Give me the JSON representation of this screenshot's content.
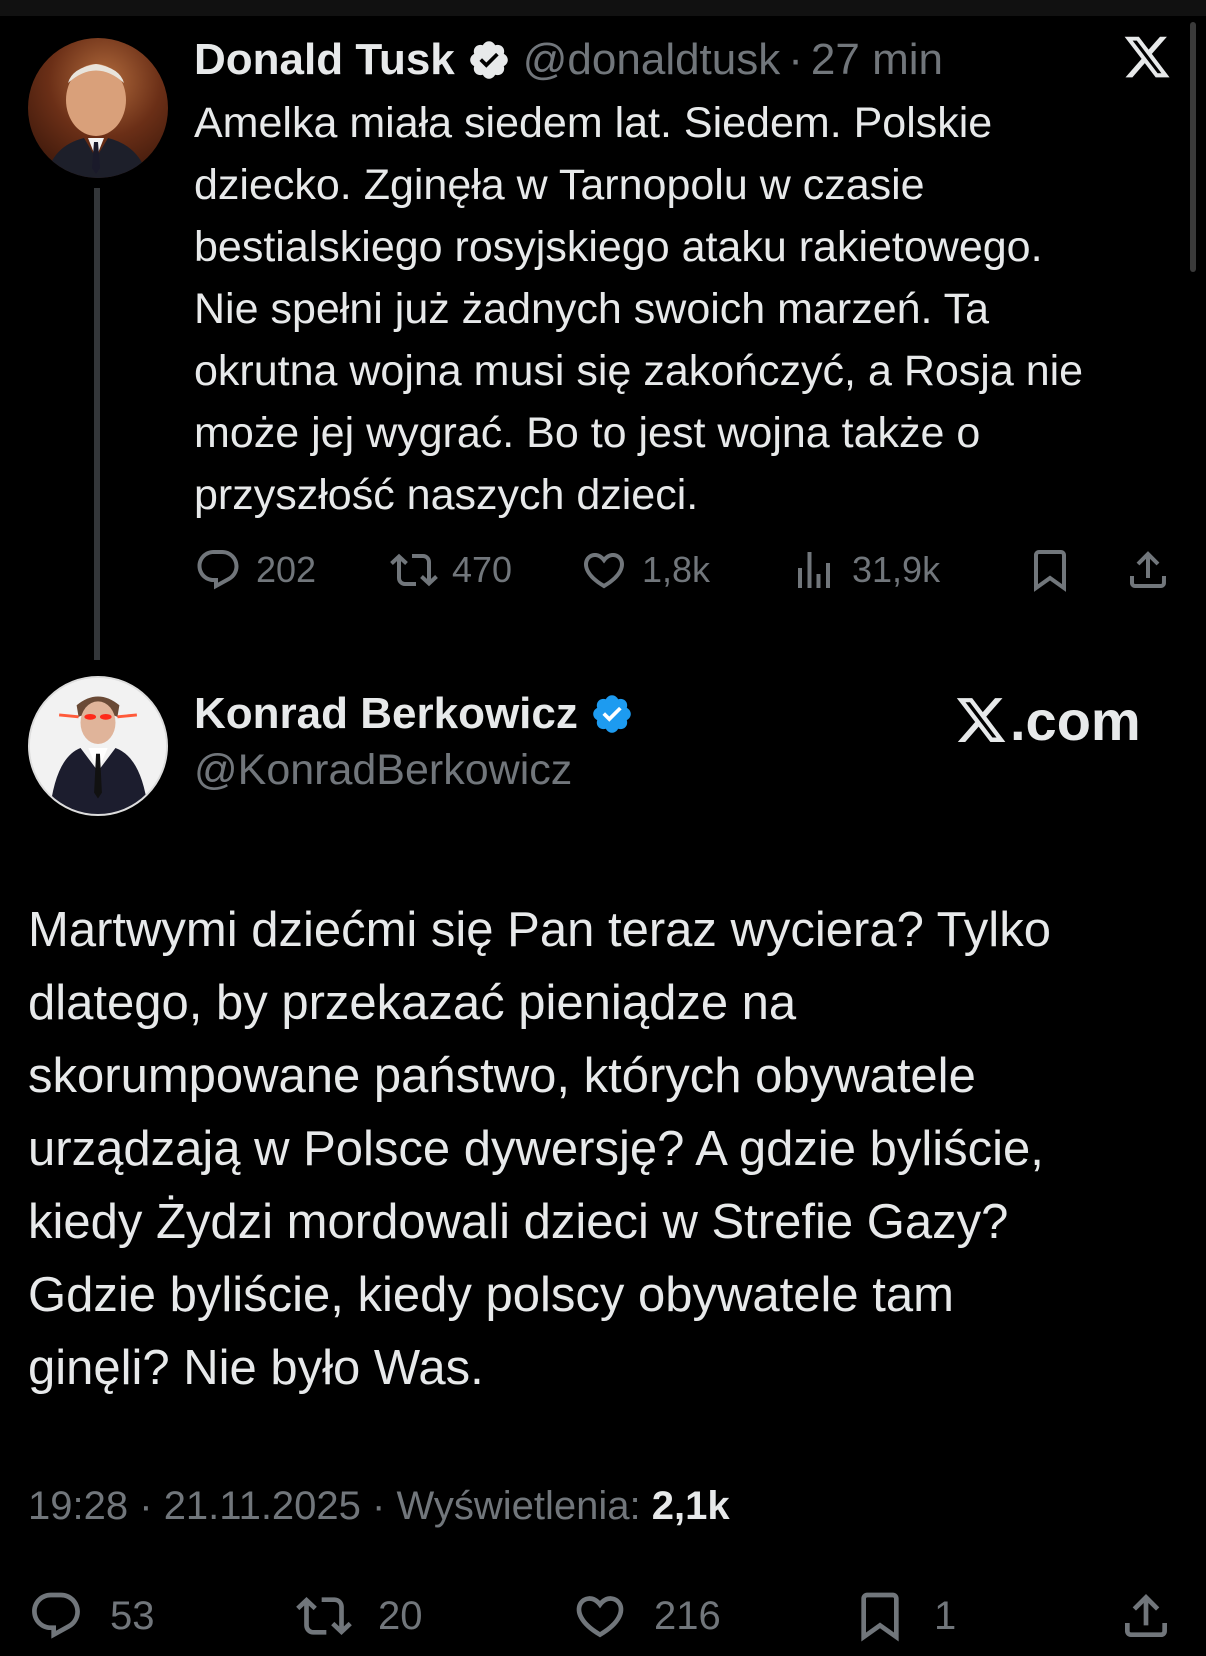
{
  "quoted_tweet": {
    "name": "Donald Tusk",
    "handle": "@donaldtusk",
    "separator": "·",
    "time": "27 min",
    "text_lines": [
      "Amelka miała siedem lat. Siedem. Polskie",
      "dziecko. Zginęła w Tarnopolu w czasie",
      "bestialskiego rosyjskiego ataku rakietowego.",
      "Nie spełni już żadnych swoich marzeń. Ta",
      "okrutna wojna musi się zakończyć, a Rosja nie",
      "może jej wygrać. Bo to jest wojna także o",
      "przyszłość naszych dzieci."
    ],
    "replies": "202",
    "reposts": "470",
    "likes": "1,8k",
    "views": "31,9k"
  },
  "main_tweet": {
    "name": "Konrad Berkowicz",
    "handle": "@KonradBerkowicz",
    "watermark": ".com",
    "text_lines": [
      "Martwymi dziećmi się Pan teraz wyciera? Tylko",
      "dlatego, by przekazać pieniądze na",
      "skorumpowane państwo, których obywatele",
      "urządzają w Polsce dywersję? A gdzie byliście,",
      "kiedy Żydzi mordowali dzieci w Strefie Gazy?",
      "Gdzie byliście, kiedy polscy obywatele tam",
      "ginęli? Nie było Was."
    ],
    "time": "19:28",
    "date": "21.11.2025",
    "views_label": "Wyświetlenia:",
    "views": "2,1k",
    "replies": "53",
    "reposts": "20",
    "likes": "216",
    "bookmarks": "1"
  },
  "colors": {
    "background": "#000000",
    "text": "#e7e9ea",
    "muted": "#71767b",
    "verified": "#1d9bf0"
  }
}
